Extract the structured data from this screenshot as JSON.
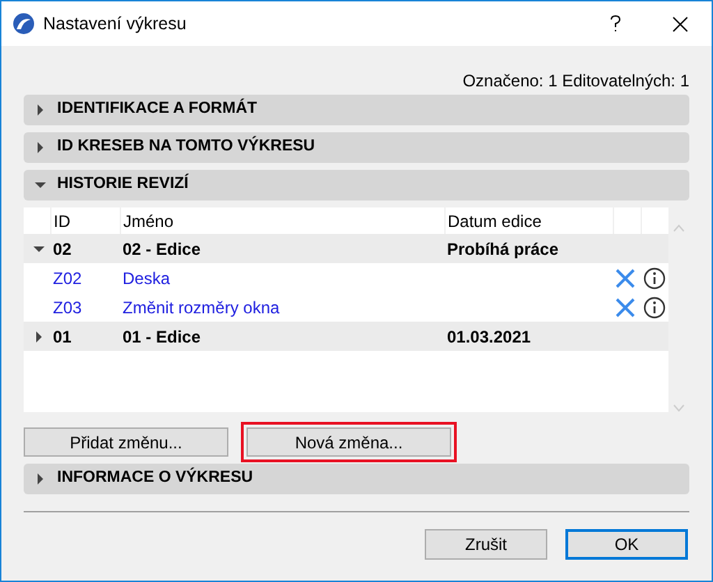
{
  "window": {
    "title": "Nastavení výkresu"
  },
  "selection_info": "Označeno: 1 Editovatelných: 1",
  "sections": [
    {
      "title": "IDENTIFIKACE A FORMÁT",
      "expanded": false
    },
    {
      "title": "ID KRESEB NA TOMTO VÝKRESU",
      "expanded": false
    },
    {
      "title": "HISTORIE REVIZÍ",
      "expanded": true
    }
  ],
  "table": {
    "columns": [
      "ID",
      "Jméno",
      "Datum edice"
    ],
    "rows": [
      {
        "kind": "group",
        "expanded": true,
        "id": "02",
        "name": "02 - Edice",
        "date": "Probíhá práce"
      },
      {
        "kind": "item",
        "id": "Z02",
        "name": "Deska"
      },
      {
        "kind": "item",
        "id": "Z03",
        "name": "Změnit rozměry okna"
      },
      {
        "kind": "group",
        "expanded": false,
        "id": "01",
        "name": "01 - Edice",
        "date": "01.03.2021"
      }
    ]
  },
  "revision_buttons": [
    {
      "label": "Přidat změnu...",
      "highlighted": false
    },
    {
      "label": "Nová změna...",
      "highlighted": true
    }
  ],
  "last_section": {
    "title": "INFORMACE O VÝKRESU",
    "expanded": false
  },
  "footer_buttons": [
    {
      "label": "Zrušit",
      "default": false
    },
    {
      "label": "OK",
      "default": true
    }
  ]
}
